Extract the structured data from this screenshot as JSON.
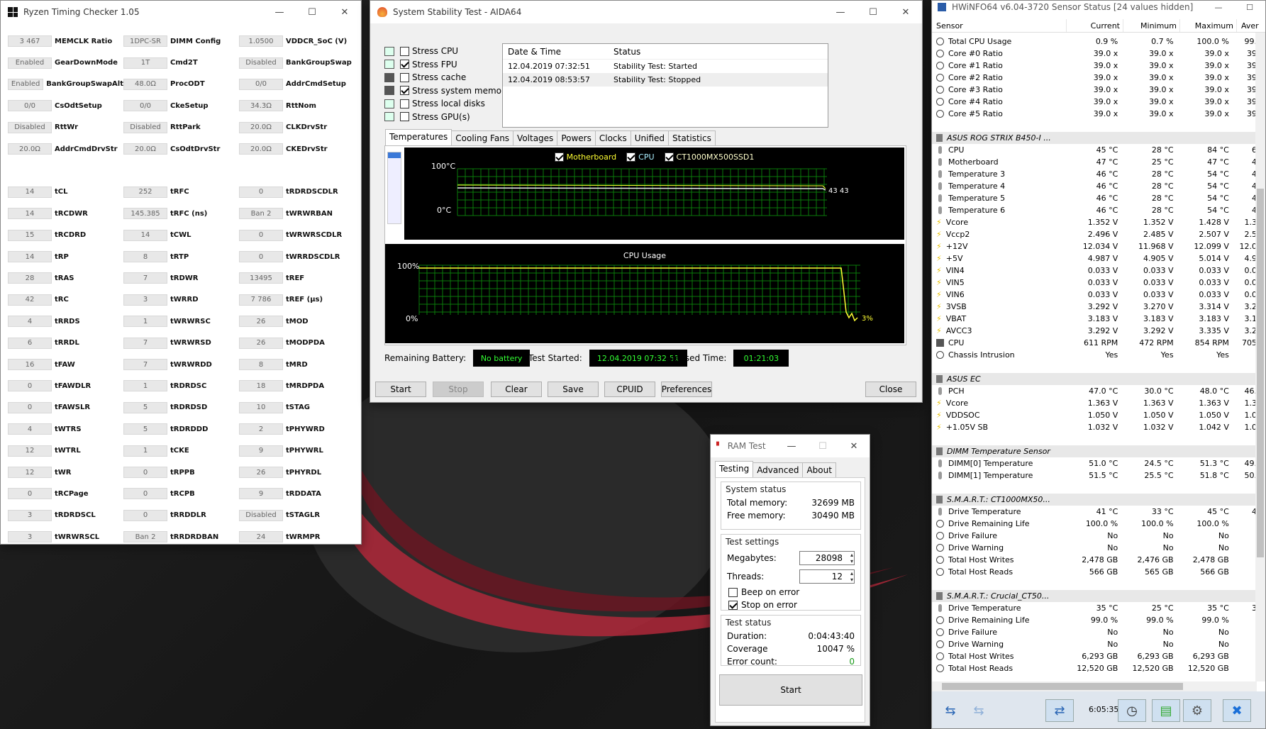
{
  "rtc": {
    "title": "Ryzen Timing Checker 1.05",
    "rows": [
      [
        [
          "3 467",
          "MEMCLK Ratio"
        ],
        [
          "1DPC-SR",
          "DIMM Config"
        ],
        [
          "1.0500",
          "VDDCR_SoC (V)"
        ]
      ],
      [
        [
          "Enabled",
          "GearDownMode"
        ],
        [
          "1T",
          "Cmd2T"
        ],
        [
          "Disabled",
          "BankGroupSwap"
        ]
      ],
      [
        [
          "Enabled",
          "BankGroupSwapAlt"
        ],
        [
          "48.0Ω",
          "ProcODT"
        ],
        [
          "0/0",
          "AddrCmdSetup"
        ]
      ],
      [
        [
          "0/0",
          "CsOdtSetup"
        ],
        [
          "0/0",
          "CkeSetup"
        ],
        [
          "34.3Ω",
          "RttNom"
        ]
      ],
      [
        [
          "Disabled",
          "RttWr"
        ],
        [
          "Disabled",
          "RttPark"
        ],
        [
          "20.0Ω",
          "CLKDrvStr"
        ]
      ],
      [
        [
          "20.0Ω",
          "AddrCmdDrvStr"
        ],
        [
          "20.0Ω",
          "CsOdtDrvStr"
        ],
        [
          "20.0Ω",
          "CKEDrvStr"
        ]
      ],
      null,
      [
        [
          "14",
          "tCL"
        ],
        [
          "252",
          "tRFC"
        ],
        [
          "0",
          "tRDRDSCDLR"
        ]
      ],
      [
        [
          "14",
          "tRCDWR"
        ],
        [
          "145.385",
          "tRFC (ns)"
        ],
        [
          "Ban 2",
          "tWRWRBAN"
        ]
      ],
      [
        [
          "15",
          "tRCDRD"
        ],
        [
          "14",
          "tCWL"
        ],
        [
          "0",
          "tWRWRSCDLR"
        ]
      ],
      [
        [
          "14",
          "tRP"
        ],
        [
          "8",
          "tRTP"
        ],
        [
          "0",
          "tWRRDSCDLR"
        ]
      ],
      [
        [
          "28",
          "tRAS"
        ],
        [
          "7",
          "tRDWR"
        ],
        [
          "13495",
          "tREF"
        ]
      ],
      [
        [
          "42",
          "tRC"
        ],
        [
          "3",
          "tWRRD"
        ],
        [
          "7 786",
          "tREF (µs)"
        ]
      ],
      [
        [
          "4",
          "tRRDS"
        ],
        [
          "1",
          "tWRWRSC"
        ],
        [
          "26",
          "tMOD"
        ]
      ],
      [
        [
          "6",
          "tRRDL"
        ],
        [
          "7",
          "tWRWRSD"
        ],
        [
          "26",
          "tMODPDA"
        ]
      ],
      [
        [
          "16",
          "tFAW"
        ],
        [
          "7",
          "tWRWRDD"
        ],
        [
          "8",
          "tMRD"
        ]
      ],
      [
        [
          "0",
          "tFAWDLR"
        ],
        [
          "1",
          "tRDRDSC"
        ],
        [
          "18",
          "tMRDPDA"
        ]
      ],
      [
        [
          "0",
          "tFAWSLR"
        ],
        [
          "5",
          "tRDRDSD"
        ],
        [
          "10",
          "tSTAG"
        ]
      ],
      [
        [
          "4",
          "tWTRS"
        ],
        [
          "5",
          "tRDRDDD"
        ],
        [
          "2",
          "tPHYWRD"
        ]
      ],
      [
        [
          "12",
          "tWTRL"
        ],
        [
          "1",
          "tCKE"
        ],
        [
          "9",
          "tPHYWRL"
        ]
      ],
      [
        [
          "12",
          "tWR"
        ],
        [
          "0",
          "tRPPB"
        ],
        [
          "26",
          "tPHYRDL"
        ]
      ],
      [
        [
          "0",
          "tRCPage"
        ],
        [
          "0",
          "tRCPB"
        ],
        [
          "9",
          "tRDDATA"
        ]
      ],
      [
        [
          "3",
          "tRDRDSCL"
        ],
        [
          "0",
          "tRRDDLR"
        ],
        [
          "Disabled",
          "tSTAGLR"
        ]
      ],
      [
        [
          "3",
          "tWRWRSCL"
        ],
        [
          "Ban 2",
          "tRRDRDBAN"
        ],
        [
          "24",
          "tWRMPR"
        ]
      ]
    ]
  },
  "aida": {
    "title": "System Stability Test - AIDA64",
    "stress": [
      {
        "label": "Stress CPU",
        "checked": false
      },
      {
        "label": "Stress FPU",
        "checked": true
      },
      {
        "label": "Stress cache",
        "checked": false
      },
      {
        "label": "Stress system memory",
        "checked": true
      },
      {
        "label": "Stress local disks",
        "checked": false
      },
      {
        "label": "Stress GPU(s)",
        "checked": false
      }
    ],
    "log_headers": [
      "Date & Time",
      "Status"
    ],
    "log": [
      [
        "12.04.2019 07:32:51",
        "Stability Test: Started"
      ],
      [
        "12.04.2019 08:53:57",
        "Stability Test: Stopped"
      ]
    ],
    "tabs": [
      "Temperatures",
      "Cooling Fans",
      "Voltages",
      "Powers",
      "Clocks",
      "Unified",
      "Statistics"
    ],
    "temp_legend": [
      "Motherboard",
      "CPU",
      "CT1000MX500SSD1"
    ],
    "temp_top": "100°C",
    "temp_bottom": "0°C",
    "temp_val": "43 43",
    "cpu_title": "CPU Usage",
    "cpu_top": "100%",
    "cpu_bottom": "0%",
    "cpu_val": "3%",
    "battery_label": "Remaining Battery:",
    "battery": "No battery",
    "started_label": "Test Started:",
    "started": "12.04.2019 07:32:51",
    "elapsed_label": "Elapsed Time:",
    "elapsed": "01:21:03",
    "buttons": [
      "Start",
      "Stop",
      "Clear",
      "Save",
      "CPUID",
      "Preferences",
      "Close"
    ]
  },
  "ram": {
    "title": "RAM Test",
    "tabs": [
      "Testing",
      "Advanced",
      "About"
    ],
    "sys_title": "System status",
    "total_label": "Total memory:",
    "total": "32699 MB",
    "free_label": "Free memory:",
    "free": "30490 MB",
    "set_title": "Test settings",
    "mb_label": "Megabytes:",
    "mb": "28098",
    "thr_label": "Threads:",
    "thr": "12",
    "beep": "Beep on error",
    "stop": "Stop on error",
    "status_title": "Test status",
    "dur_label": "Duration:",
    "dur": "0:04:43:40",
    "cov_label": "Coverage",
    "cov": "10047 %",
    "err_label": "Error count:",
    "err": "0",
    "start": "Start"
  },
  "hw": {
    "title": "HWiNFO64 v6.04-3720 Sensor Status [24 values hidden]",
    "headers": [
      "Sensor",
      "Current",
      "Minimum",
      "Maximum",
      "Aver"
    ],
    "rows": [
      {
        "i": "clock",
        "n": "Total CPU Usage",
        "c": "0.9 %",
        "mi": "0.7 %",
        "ma": "100.0 %",
        "a": "99."
      },
      {
        "i": "clock",
        "n": "Core #0 Ratio",
        "c": "39.0 x",
        "mi": "39.0 x",
        "ma": "39.0 x",
        "a": "39"
      },
      {
        "i": "clock",
        "n": "Core #1 Ratio",
        "c": "39.0 x",
        "mi": "39.0 x",
        "ma": "39.0 x",
        "a": "39"
      },
      {
        "i": "clock",
        "n": "Core #2 Ratio",
        "c": "39.0 x",
        "mi": "39.0 x",
        "ma": "39.0 x",
        "a": "39"
      },
      {
        "i": "clock",
        "n": "Core #3 Ratio",
        "c": "39.0 x",
        "mi": "39.0 x",
        "ma": "39.0 x",
        "a": "39"
      },
      {
        "i": "clock",
        "n": "Core #4 Ratio",
        "c": "39.0 x",
        "mi": "39.0 x",
        "ma": "39.0 x",
        "a": "39"
      },
      {
        "i": "clock",
        "n": "Core #5 Ratio",
        "c": "39.0 x",
        "mi": "39.0 x",
        "ma": "39.0 x",
        "a": "39"
      },
      {
        "blank": true
      },
      {
        "sec": true,
        "i": "chip",
        "n": "ASUS ROG STRIX B450-I ..."
      },
      {
        "i": "therm",
        "n": "CPU",
        "c": "45 °C",
        "mi": "28 °C",
        "ma": "84 °C",
        "a": "6"
      },
      {
        "i": "therm",
        "n": "Motherboard",
        "c": "47 °C",
        "mi": "25 °C",
        "ma": "47 °C",
        "a": "4"
      },
      {
        "i": "therm",
        "n": "Temperature 3",
        "c": "46 °C",
        "mi": "28 °C",
        "ma": "54 °C",
        "a": "4"
      },
      {
        "i": "therm",
        "n": "Temperature 4",
        "c": "46 °C",
        "mi": "28 °C",
        "ma": "54 °C",
        "a": "4"
      },
      {
        "i": "therm",
        "n": "Temperature 5",
        "c": "46 °C",
        "mi": "28 °C",
        "ma": "54 °C",
        "a": "4"
      },
      {
        "i": "therm",
        "n": "Temperature 6",
        "c": "46 °C",
        "mi": "28 °C",
        "ma": "54 °C",
        "a": "4"
      },
      {
        "i": "volt",
        "n": "Vcore",
        "c": "1.352 V",
        "mi": "1.352 V",
        "ma": "1.428 V",
        "a": "1.3"
      },
      {
        "i": "volt",
        "n": "Vccp2",
        "c": "2.496 V",
        "mi": "2.485 V",
        "ma": "2.507 V",
        "a": "2.5"
      },
      {
        "i": "volt",
        "n": "+12V",
        "c": "12.034 V",
        "mi": "11.968 V",
        "ma": "12.099 V",
        "a": "12.0"
      },
      {
        "i": "volt",
        "n": "+5V",
        "c": "4.987 V",
        "mi": "4.905 V",
        "ma": "5.014 V",
        "a": "4.9"
      },
      {
        "i": "volt",
        "n": "VIN4",
        "c": "0.033 V",
        "mi": "0.033 V",
        "ma": "0.033 V",
        "a": "0.0"
      },
      {
        "i": "volt",
        "n": "VIN5",
        "c": "0.033 V",
        "mi": "0.033 V",
        "ma": "0.033 V",
        "a": "0.0"
      },
      {
        "i": "volt",
        "n": "VIN6",
        "c": "0.033 V",
        "mi": "0.033 V",
        "ma": "0.033 V",
        "a": "0.0"
      },
      {
        "i": "volt",
        "n": "3VSB",
        "c": "3.292 V",
        "mi": "3.270 V",
        "ma": "3.314 V",
        "a": "3.2"
      },
      {
        "i": "volt",
        "n": "VBAT",
        "c": "3.183 V",
        "mi": "3.183 V",
        "ma": "3.183 V",
        "a": "3.1"
      },
      {
        "i": "volt",
        "n": "AVCC3",
        "c": "3.292 V",
        "mi": "3.292 V",
        "ma": "3.335 V",
        "a": "3.2"
      },
      {
        "i": "fan",
        "n": "CPU",
        "c": "611 RPM",
        "mi": "472 RPM",
        "ma": "854 RPM",
        "a": "705"
      },
      {
        "i": "clock",
        "n": "Chassis Intrusion",
        "c": "Yes",
        "mi": "Yes",
        "ma": "Yes",
        "a": ""
      },
      {
        "blank": true
      },
      {
        "sec": true,
        "i": "chip",
        "n": "ASUS EC"
      },
      {
        "i": "therm",
        "n": "PCH",
        "c": "47.0 °C",
        "mi": "30.0 °C",
        "ma": "48.0 °C",
        "a": "46."
      },
      {
        "i": "volt",
        "n": "Vcore",
        "c": "1.363 V",
        "mi": "1.363 V",
        "ma": "1.363 V",
        "a": "1.3"
      },
      {
        "i": "volt",
        "n": "VDDSOC",
        "c": "1.050 V",
        "mi": "1.050 V",
        "ma": "1.050 V",
        "a": "1.0"
      },
      {
        "i": "volt",
        "n": "+1.05V SB",
        "c": "1.032 V",
        "mi": "1.032 V",
        "ma": "1.042 V",
        "a": "1.0"
      },
      {
        "blank": true
      },
      {
        "sec": true,
        "i": "chip",
        "n": "DIMM Temperature Sensor"
      },
      {
        "i": "therm",
        "n": "DIMM[0] Temperature",
        "c": "51.0 °C",
        "mi": "24.5 °C",
        "ma": "51.3 °C",
        "a": "49."
      },
      {
        "i": "therm",
        "n": "DIMM[1] Temperature",
        "c": "51.5 °C",
        "mi": "25.5 °C",
        "ma": "51.8 °C",
        "a": "50."
      },
      {
        "blank": true
      },
      {
        "sec": true,
        "i": "chip",
        "n": "S.M.A.R.T.: CT1000MX50..."
      },
      {
        "i": "therm",
        "n": "Drive Temperature",
        "c": "41 °C",
        "mi": "33 °C",
        "ma": "45 °C",
        "a": "4"
      },
      {
        "i": "clock",
        "n": "Drive Remaining Life",
        "c": "100.0 %",
        "mi": "100.0 %",
        "ma": "100.0 %",
        "a": ""
      },
      {
        "i": "clock",
        "n": "Drive Failure",
        "c": "No",
        "mi": "No",
        "ma": "No",
        "a": ""
      },
      {
        "i": "clock",
        "n": "Drive Warning",
        "c": "No",
        "mi": "No",
        "ma": "No",
        "a": ""
      },
      {
        "i": "clock",
        "n": "Total Host Writes",
        "c": "2,478 GB",
        "mi": "2,476 GB",
        "ma": "2,478 GB",
        "a": ""
      },
      {
        "i": "clock",
        "n": "Total Host Reads",
        "c": "566 GB",
        "mi": "565 GB",
        "ma": "566 GB",
        "a": ""
      },
      {
        "blank": true
      },
      {
        "sec": true,
        "i": "chip",
        "n": "S.M.A.R.T.: Crucial_CT50..."
      },
      {
        "i": "therm",
        "n": "Drive Temperature",
        "c": "35 °C",
        "mi": "25 °C",
        "ma": "35 °C",
        "a": "3"
      },
      {
        "i": "clock",
        "n": "Drive Remaining Life",
        "c": "99.0 %",
        "mi": "99.0 %",
        "ma": "99.0 %",
        "a": ""
      },
      {
        "i": "clock",
        "n": "Drive Failure",
        "c": "No",
        "mi": "No",
        "ma": "No",
        "a": ""
      },
      {
        "i": "clock",
        "n": "Drive Warning",
        "c": "No",
        "mi": "No",
        "ma": "No",
        "a": ""
      },
      {
        "i": "clock",
        "n": "Total Host Writes",
        "c": "6,293 GB",
        "mi": "6,293 GB",
        "ma": "6,293 GB",
        "a": ""
      },
      {
        "i": "clock",
        "n": "Total Host Reads",
        "c": "12,520 GB",
        "mi": "12,520 GB",
        "ma": "12,520 GB",
        "a": ""
      }
    ],
    "time": "6:05:35"
  }
}
